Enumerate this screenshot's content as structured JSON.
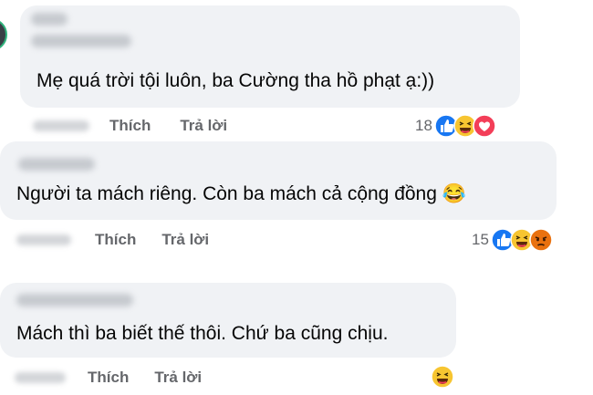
{
  "comments": [
    {
      "text": "Mẹ quá trời tội luôn, ba Cường tha hồ phạt ạ:))",
      "like_label": "Thích",
      "reply_label": "Trả lời",
      "reaction_count": "18",
      "reaction_icons": [
        "like-icon",
        "haha-icon",
        "love-icon"
      ]
    },
    {
      "text": "Người ta mách riêng. Còn ba mách cả cộng đồng 😂",
      "like_label": "Thích",
      "reply_label": "Trả lời",
      "reaction_count": "15",
      "reaction_icons": [
        "like-icon",
        "haha-icon",
        "angry-icon"
      ]
    },
    {
      "text": "Mách thì ba biết thế thôi. Chứ ba cũng chịu.",
      "like_label": "Thích",
      "reply_label": "Trả lời",
      "reaction_count": "",
      "reaction_icons": [
        "haha-icon"
      ]
    }
  ],
  "colors": {
    "bubble": "#f0f2f5",
    "meta_text": "#65676b",
    "like_blue": "#1877f2",
    "haha_yellow": "#f7c531",
    "love_red": "#f33e58",
    "angry_orange": "#e9710f"
  }
}
